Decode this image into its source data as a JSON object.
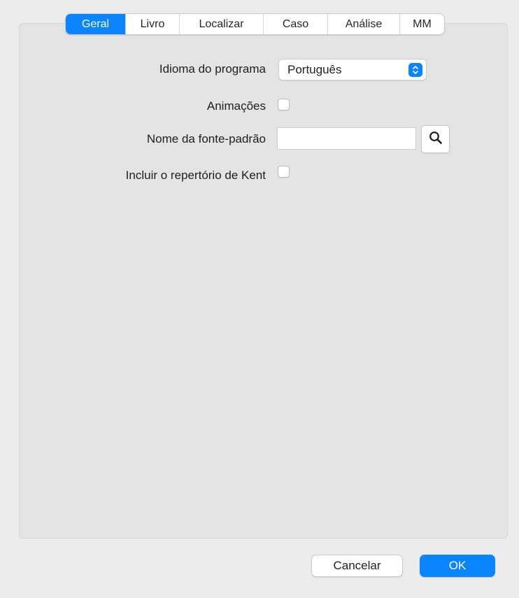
{
  "tabs": [
    {
      "label": "Geral",
      "active": true
    },
    {
      "label": "Livro",
      "active": false
    },
    {
      "label": "Localizar",
      "active": false
    },
    {
      "label": "Caso",
      "active": false
    },
    {
      "label": "Análise",
      "active": false
    },
    {
      "label": "MM",
      "active": false
    }
  ],
  "form": {
    "language_label": "Idioma do programa",
    "language_value": "Português",
    "animations_label": "Animações",
    "animations_checked": false,
    "font_label": "Nome da fonte-padrão",
    "font_value": "",
    "kent_label": "Incluir o repertório de Kent",
    "kent_checked": false
  },
  "buttons": {
    "cancel_label": "Cancelar",
    "ok_label": "OK"
  },
  "icons": {
    "select_stepper": "chevron-up-down-icon",
    "search": "search-icon"
  },
  "colors": {
    "accent": "#0b84ff",
    "window_bg": "#ececec",
    "panel_bg": "#e4e4e4"
  }
}
